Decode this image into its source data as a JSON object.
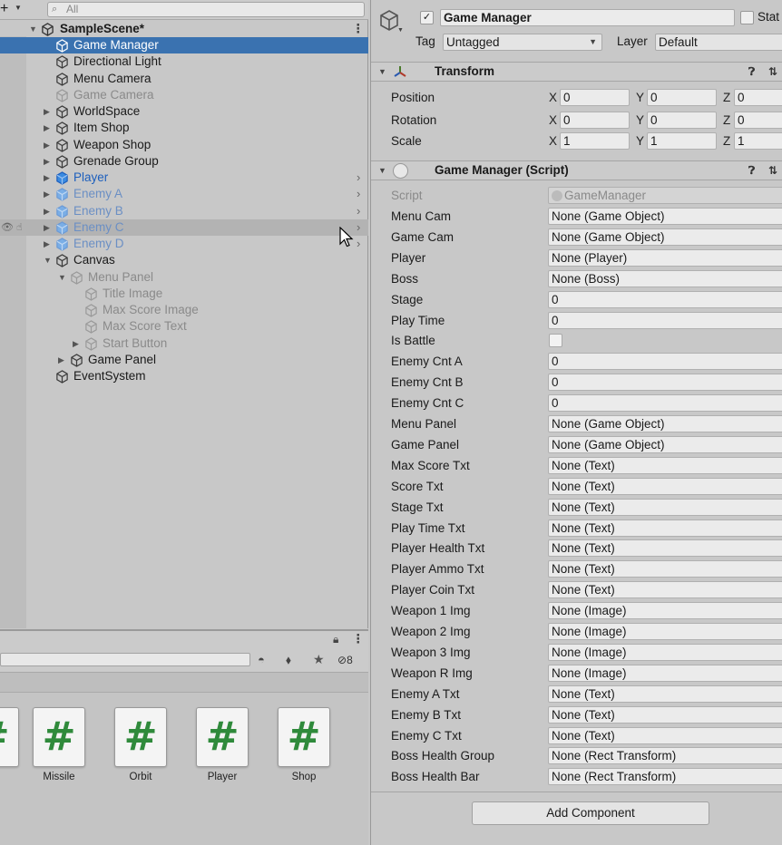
{
  "hierarchy": {
    "add_label": "+",
    "search_placeholder": "All",
    "scene_name": "SampleScene*",
    "items": [
      {
        "label": "Game Manager",
        "depth": 1,
        "arrow": "",
        "style": "sel"
      },
      {
        "label": "Directional Light",
        "depth": 1,
        "arrow": "",
        "style": ""
      },
      {
        "label": "Menu Camera",
        "depth": 1,
        "arrow": "",
        "style": ""
      },
      {
        "label": "Game Camera",
        "depth": 1,
        "arrow": "",
        "style": "dim"
      },
      {
        "label": "WorldSpace",
        "depth": 1,
        "arrow": "▶",
        "style": ""
      },
      {
        "label": "Item Shop",
        "depth": 1,
        "arrow": "▶",
        "style": ""
      },
      {
        "label": "Weapon Shop",
        "depth": 1,
        "arrow": "▶",
        "style": ""
      },
      {
        "label": "Grenade Group",
        "depth": 1,
        "arrow": "▶",
        "style": ""
      },
      {
        "label": "Player",
        "depth": 1,
        "arrow": "▶",
        "style": "prefab"
      },
      {
        "label": "Enemy A",
        "depth": 1,
        "arrow": "▶",
        "style": "prefab-dim"
      },
      {
        "label": "Enemy B",
        "depth": 1,
        "arrow": "▶",
        "style": "prefab-dim"
      },
      {
        "label": "Enemy C",
        "depth": 1,
        "arrow": "▶",
        "style": "prefab-dim hov"
      },
      {
        "label": "Enemy D",
        "depth": 1,
        "arrow": "▶",
        "style": "prefab-dim"
      },
      {
        "label": "Canvas",
        "depth": 1,
        "arrow": "▼",
        "style": ""
      },
      {
        "label": "Menu Panel",
        "depth": 2,
        "arrow": "▼",
        "style": "dim"
      },
      {
        "label": "Title Image",
        "depth": 3,
        "arrow": "",
        "style": "dim"
      },
      {
        "label": "Max Score Image",
        "depth": 3,
        "arrow": "",
        "style": "dim"
      },
      {
        "label": "Max Score Text",
        "depth": 3,
        "arrow": "",
        "style": "dim"
      },
      {
        "label": "Start Button",
        "depth": 3,
        "arrow": "▶",
        "style": "dim"
      },
      {
        "label": "Game Panel",
        "depth": 2,
        "arrow": "▶",
        "style": ""
      },
      {
        "label": "EventSystem",
        "depth": 1,
        "arrow": "",
        "style": ""
      }
    ]
  },
  "project": {
    "hidden_count": "8",
    "files": [
      {
        "name": "Missile"
      },
      {
        "name": "Orbit"
      },
      {
        "name": "Player"
      },
      {
        "name": "Shop"
      }
    ]
  },
  "inspector": {
    "object_name": "Game Manager",
    "static_label": "Stat",
    "tag_label": "Tag",
    "tag_value": "Untagged",
    "layer_label": "Layer",
    "layer_value": "Default",
    "transform": {
      "title": "Transform",
      "rows": [
        {
          "label": "Position",
          "x": "0",
          "y": "0",
          "z": "0"
        },
        {
          "label": "Rotation",
          "x": "0",
          "y": "0",
          "z": "0"
        },
        {
          "label": "Scale",
          "x": "1",
          "y": "1",
          "z": "1"
        }
      ],
      "axis_x": "X",
      "axis_y": "Y",
      "axis_z": "Z"
    },
    "script_component": {
      "title": "Game Manager (Script)",
      "script_label": "Script",
      "script_value": "GameManager",
      "fields": [
        {
          "label": "Menu Cam",
          "value": "None (Game Object)"
        },
        {
          "label": "Game Cam",
          "value": "None (Game Object)"
        },
        {
          "label": "Player",
          "value": "None (Player)"
        },
        {
          "label": "Boss",
          "value": "None (Boss)"
        },
        {
          "label": "Stage",
          "value": "0"
        },
        {
          "label": "Play Time",
          "value": "0"
        },
        {
          "label": "Is Battle",
          "value": "",
          "checkbox": true
        },
        {
          "label": "Enemy Cnt A",
          "value": "0"
        },
        {
          "label": "Enemy Cnt B",
          "value": "0"
        },
        {
          "label": "Enemy Cnt C",
          "value": "0"
        },
        {
          "label": "Menu Panel",
          "value": "None (Game Object)"
        },
        {
          "label": "Game Panel",
          "value": "None (Game Object)"
        },
        {
          "label": "Max Score Txt",
          "value": "None (Text)"
        },
        {
          "label": "Score Txt",
          "value": "None (Text)"
        },
        {
          "label": "Stage Txt",
          "value": "None (Text)"
        },
        {
          "label": "Play Time Txt",
          "value": "None (Text)"
        },
        {
          "label": "Player Health Txt",
          "value": "None (Text)"
        },
        {
          "label": "Player Ammo Txt",
          "value": "None (Text)"
        },
        {
          "label": "Player Coin Txt",
          "value": "None (Text)"
        },
        {
          "label": "Weapon 1 Img",
          "value": "None (Image)"
        },
        {
          "label": "Weapon 2 Img",
          "value": "None (Image)"
        },
        {
          "label": "Weapon 3 Img",
          "value": "None (Image)"
        },
        {
          "label": "Weapon R Img",
          "value": "None (Image)"
        },
        {
          "label": "Enemy A Txt",
          "value": "None (Text)"
        },
        {
          "label": "Enemy B Txt",
          "value": "None (Text)"
        },
        {
          "label": "Enemy C Txt",
          "value": "None (Text)"
        },
        {
          "label": "Boss Health Group",
          "value": "None (Rect Transform)"
        },
        {
          "label": "Boss Health Bar",
          "value": "None (Rect Transform)"
        }
      ]
    },
    "add_component_label": "Add Component"
  }
}
